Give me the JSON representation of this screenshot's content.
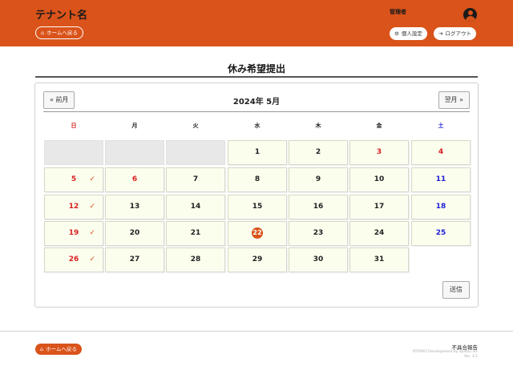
{
  "header": {
    "tenant_name": "テナント名",
    "home_label": "ホームへ戻る",
    "admin_label": "管理者",
    "personal_settings_label": "個人設定",
    "logout_label": "ログアウト"
  },
  "page": {
    "title": "休み希望提出"
  },
  "calendar": {
    "prev_label": "« 前月",
    "next_label": "翌月 »",
    "month_label": "2024年 5月",
    "weekdays": [
      "日",
      "月",
      "火",
      "水",
      "木",
      "金",
      "土"
    ],
    "today": 22,
    "holidays_red": [
      3,
      4,
      6
    ],
    "checked_days": [
      5,
      12,
      19,
      26
    ],
    "check_mark": "✓",
    "weeks": [
      [
        "",
        "",
        "",
        "1",
        "2",
        "3",
        "4"
      ],
      [
        "5",
        "6",
        "7",
        "8",
        "9",
        "10",
        "11"
      ],
      [
        "12",
        "13",
        "14",
        "15",
        "16",
        "17",
        "18"
      ],
      [
        "19",
        "20",
        "21",
        "22",
        "23",
        "24",
        "25"
      ],
      [
        "26",
        "27",
        "28",
        "29",
        "30",
        "31",
        null
      ]
    ],
    "submit_label": "送信"
  },
  "footer": {
    "home_label": "ホームへ戻る",
    "report_label": "不具合報告",
    "copyright": "YOTARO Development by ayatsu inc",
    "version": "Ver. 3.1"
  },
  "colors": {
    "brand": "#d9531a",
    "sunday": "#d92020",
    "saturday": "#2020d9",
    "cell_bg": "#fbfded",
    "empty_cell_bg": "#e8e8e8"
  }
}
